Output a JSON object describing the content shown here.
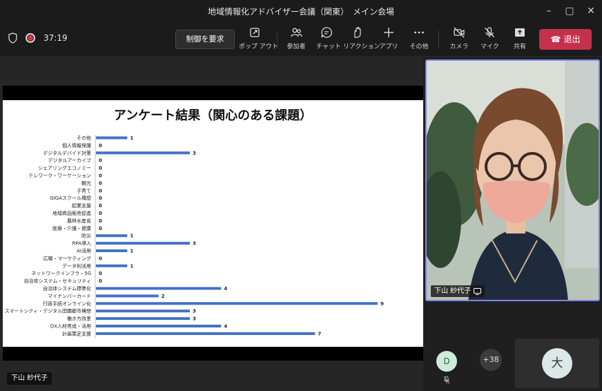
{
  "window": {
    "title": "地域情報化アドバイザー会議（関東）　メイン会場"
  },
  "toolbar": {
    "timer": "37:19",
    "control_label": "制御を要求",
    "items": [
      {
        "label": "ポップ アウト",
        "icon": "popout-icon"
      },
      {
        "label": "参加者",
        "icon": "participants-icon"
      },
      {
        "label": "チャット",
        "icon": "chat-icon"
      },
      {
        "label": "リアクション",
        "icon": "reaction-icon"
      },
      {
        "label": "アプリ",
        "icon": "plus-icon"
      },
      {
        "label": "その他",
        "icon": "more-icon"
      },
      {
        "label": "カメラ",
        "icon": "camera-off-icon"
      },
      {
        "label": "マイク",
        "icon": "mic-off-icon"
      },
      {
        "label": "共有",
        "icon": "share-icon"
      }
    ],
    "leave_label": "退出",
    "leave_color": "#c4314b"
  },
  "stage": {
    "presenter_name": "下山 紗代子"
  },
  "chart_data": {
    "type": "bar",
    "orientation": "horizontal",
    "title": "アンケート結果（関心のある課題）",
    "bar_color": "#4472c4",
    "categories": [
      "その他",
      "個人情報保護",
      "デジタルデバイド対策",
      "デジタルアーカイブ",
      "シェアリングエコノミー",
      "テレワーク・ワーケーション",
      "観光",
      "子育て",
      "GIGAスクール構想",
      "起業支援",
      "地域商品販売促進",
      "農林水産省",
      "医療・介護・健康",
      "防災",
      "RPA導入",
      "AI活用",
      "広報・マーケティング",
      "データ利活用",
      "ネットワークインフラ・5G",
      "自治体システム・セキュリティ",
      "自治体システム標準化",
      "マイナンバーカード",
      "行政手続オンライン化",
      "スマートシティ・デジタル田園都市構想",
      "働き方改革",
      "DX人材育成・活用",
      "計画策定支援"
    ],
    "values": [
      1,
      0,
      3,
      0,
      0,
      0,
      0,
      0,
      0,
      0,
      0,
      0,
      0,
      1,
      3,
      1,
      0,
      1,
      0,
      0,
      4,
      2,
      9,
      3,
      3,
      4,
      7
    ],
    "xlim": [
      0,
      9
    ]
  },
  "video": {
    "name": "下山 紗代子"
  },
  "participants": {
    "avatar_d": "D",
    "more_count": "+38",
    "avatar_big": "大"
  }
}
